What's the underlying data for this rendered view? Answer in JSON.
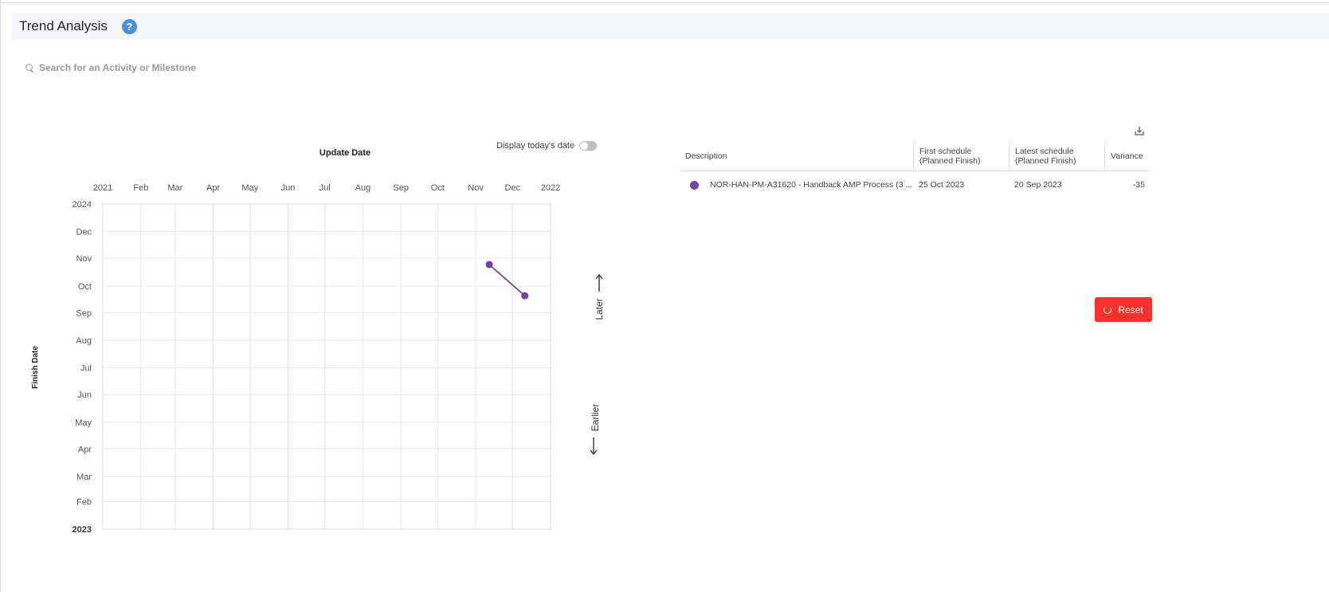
{
  "header": {
    "title": "Trend Analysis",
    "help_icon": "?"
  },
  "search": {
    "placeholder": "Search for an Activity or Milestone",
    "value": ""
  },
  "chart_controls": {
    "display_today_label": "Display today's date",
    "display_today_on": false
  },
  "arrows": {
    "later_label": "Later",
    "earlier_label": "Earlier"
  },
  "chart_data": {
    "type": "line",
    "title": "Update Date",
    "xlabel": "Update Date",
    "ylabel": "Finish Date",
    "x_ticks": [
      "2021",
      "Feb",
      "Mar",
      "Apr",
      "May",
      "Jun",
      "Jul",
      "Aug",
      "Sep",
      "Oct",
      "Nov",
      "Dec",
      "2022"
    ],
    "y_ticks": [
      "2024",
      "Dec",
      "Nov",
      "Oct",
      "Sep",
      "Aug",
      "Jul",
      "Jun",
      "May",
      "Apr",
      "Mar",
      "Feb",
      "2023"
    ],
    "xlim": [
      "2021-01-01",
      "2022-01-01"
    ],
    "ylim": [
      "2023-01-01",
      "2024-01-01"
    ],
    "grid": true,
    "series": [
      {
        "color": "#7c3fa0",
        "points": [
          {
            "x": "2021-11-12",
            "y": "2023-10-25"
          },
          {
            "x": "2021-12-11",
            "y": "2023-09-20"
          }
        ]
      }
    ]
  },
  "table": {
    "headers": [
      "Description",
      "First schedule\n(Planned Finish)",
      "Latest schedule\n(Planned Finish)",
      "Variance"
    ],
    "header_lines": [
      [
        "Description"
      ],
      [
        "First schedule",
        "(Planned Finish)"
      ],
      [
        "Latest schedule",
        "(Planned Finish)"
      ],
      [
        "Variance"
      ]
    ],
    "rows": [
      {
        "color": "#7c3fa0",
        "description": "NOR-HAN-PM-A31620 - Handback AMP Process (3 ...",
        "first": "25 Oct 2023",
        "latest": "20 Sep 2023",
        "variance": "-35"
      }
    ]
  },
  "reset_button": {
    "label": "Reset"
  },
  "icons": {
    "search": "search-icon",
    "download": "download-icon",
    "reset": "refresh-icon",
    "help": "question-circle-icon"
  }
}
